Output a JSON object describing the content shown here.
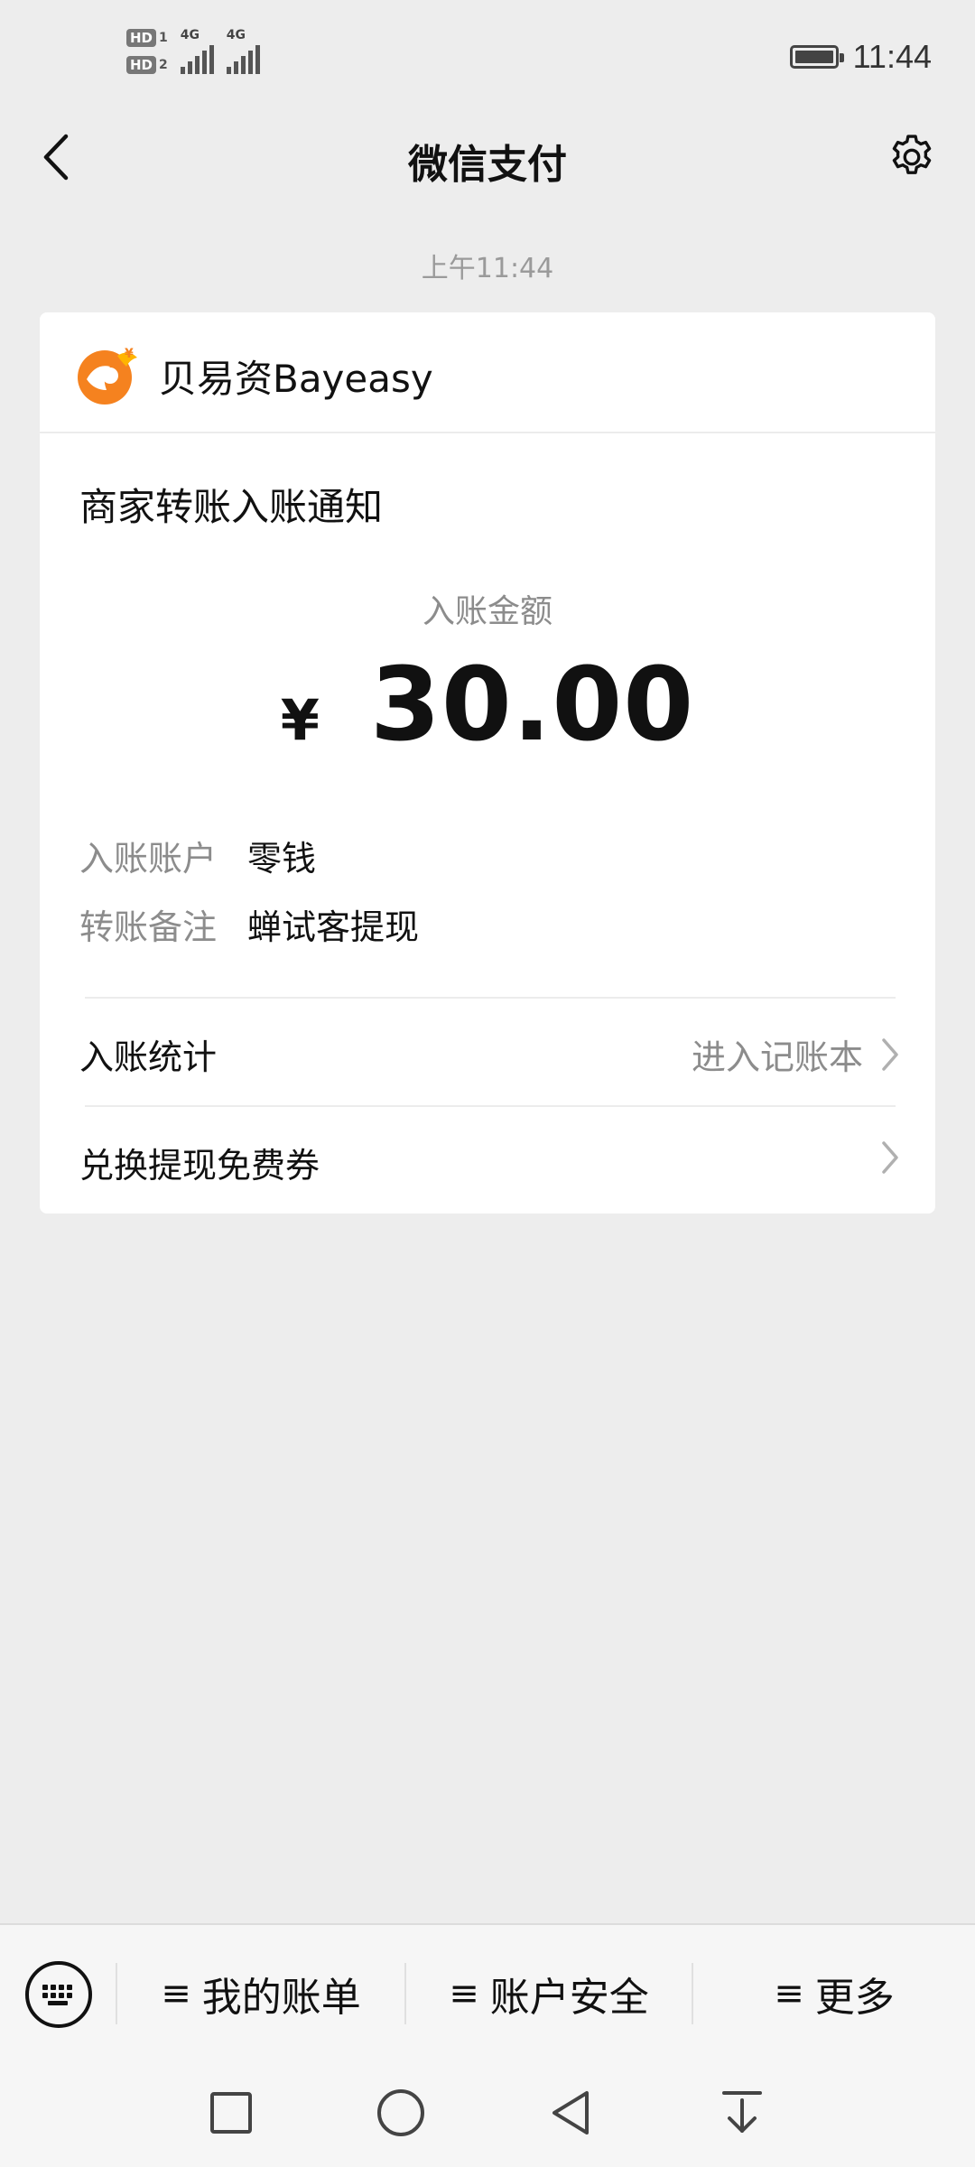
{
  "status_bar": {
    "sim1_badge": "HD",
    "sim1_number": "1",
    "sim2_badge": "HD",
    "sim2_number": "2",
    "network1": "4G",
    "network2": "4G",
    "time": "11:44",
    "battery_level": 1.0
  },
  "nav": {
    "title": "微信支付",
    "back_icon": "chevron-left-icon",
    "settings_icon": "gear-icon"
  },
  "message": {
    "timestamp": "上午11:44"
  },
  "card": {
    "merchant_name": "贝易资Bayeasy",
    "notice_title": "商家转账入账通知",
    "amount_label": "入账金额",
    "currency": "¥",
    "amount": "30.00",
    "details": [
      {
        "key": "入账账户",
        "value": "零钱"
      },
      {
        "key": "转账备注",
        "value": "蝉试客提现"
      }
    ],
    "rows": [
      {
        "label": "入账统计",
        "action": "进入记账本"
      },
      {
        "label": "兑换提现免费券",
        "action": ""
      }
    ],
    "colors": {
      "logo_orange": "#f5821f",
      "logo_yellow": "#ffb400"
    }
  },
  "bottom_menu": {
    "items": [
      {
        "icon": "≡",
        "label": "我的账单"
      },
      {
        "icon": "≡",
        "label": "账户安全"
      },
      {
        "icon": "≡",
        "label": "更多"
      }
    ]
  }
}
